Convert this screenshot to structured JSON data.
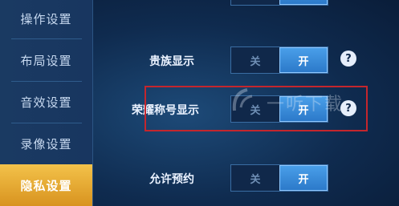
{
  "sidebar": {
    "items": [
      {
        "label": "操作设置",
        "active": false
      },
      {
        "label": "布局设置",
        "active": false
      },
      {
        "label": "音效设置",
        "active": false
      },
      {
        "label": "录像设置",
        "active": false
      },
      {
        "label": "隐私设置",
        "active": true
      }
    ]
  },
  "settings": {
    "rows": [
      {
        "label": "",
        "off": "",
        "on": "",
        "selected": "on",
        "help": ""
      },
      {
        "label": "贵族显示",
        "off": "关",
        "on": "开",
        "selected": "on",
        "help": "?"
      },
      {
        "label": "荣耀称号显示",
        "off": "关",
        "on": "开",
        "selected": "on",
        "help": "?"
      },
      {
        "label": "允许预约",
        "off": "关",
        "on": "开",
        "selected": "on",
        "help": ""
      }
    ]
  },
  "watermark": {
    "text": "一听下载"
  },
  "colors": {
    "accent_active_tab": "#e3a635",
    "toggle_on": "#3b8edb",
    "highlight_border": "#c4262d",
    "background": "#0b1f3d"
  }
}
